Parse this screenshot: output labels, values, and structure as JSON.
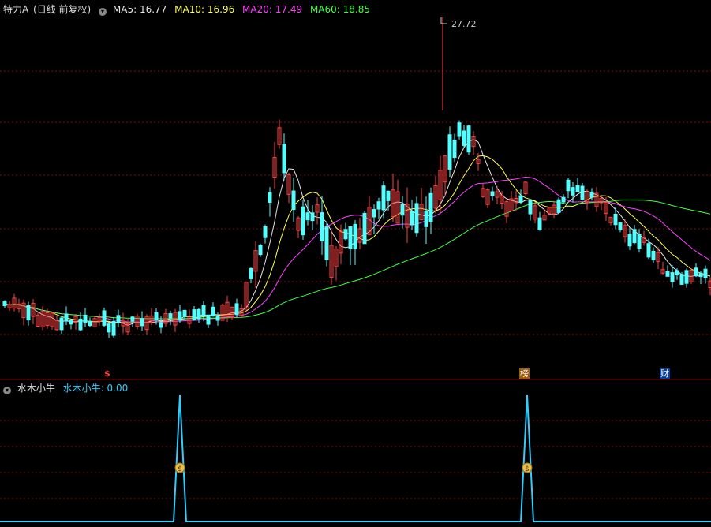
{
  "header": {
    "title": "特力A",
    "mode": "(日线 前复权)",
    "ma": [
      {
        "label": "MA5:",
        "value": "16.77",
        "color": "#e6e6e6"
      },
      {
        "label": "MA10:",
        "value": "16.96",
        "color": "#ffff54"
      },
      {
        "label": "MA20:",
        "value": "17.49",
        "color": "#ff40ff"
      },
      {
        "label": "MA60:",
        "value": "18.85",
        "color": "#40ff40"
      }
    ]
  },
  "price_chart": {
    "peak_label": "27.72",
    "up_color": "#ff4040",
    "down_color": "#54ffff"
  },
  "event_marks": [
    {
      "text": "$",
      "color": "#ff4040"
    },
    {
      "text": "榜",
      "color": "#ffffff",
      "bg": "#a05a00"
    },
    {
      "text": "财",
      "color": "#ffffff",
      "bg": "#0040a0"
    }
  ],
  "indicator": {
    "name": "水木小牛",
    "line_label": "水木小牛:",
    "line_value": "0.00",
    "line_color": "#33ccff",
    "signal_icon": "money-bag-icon"
  }
}
